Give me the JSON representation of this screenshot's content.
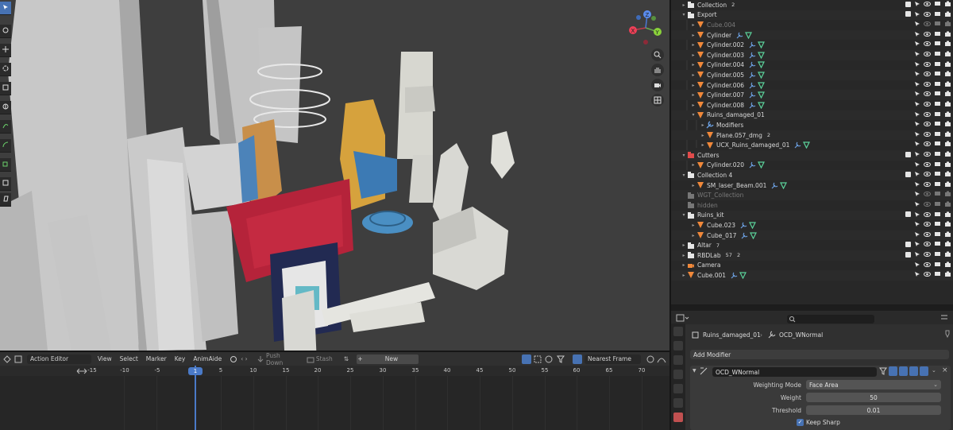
{
  "outliner": {
    "rows": [
      {
        "label": "Collection",
        "dim": false
      },
      {
        "label": "Export",
        "dim": false
      },
      {
        "label": "Cube.004",
        "dim": true
      },
      {
        "label": "Cylinder",
        "dim": false
      },
      {
        "label": "Cylinder.002",
        "dim": false
      },
      {
        "label": "Cylinder.003",
        "dim": false
      },
      {
        "label": "Cylinder.004",
        "dim": false
      },
      {
        "label": "Cylinder.005",
        "dim": false
      },
      {
        "label": "Cylinder.006",
        "dim": false
      },
      {
        "label": "Cylinder.007",
        "dim": false
      },
      {
        "label": "Cylinder.008",
        "dim": false
      },
      {
        "label": "Ruins_damaged_01",
        "dim": false
      },
      {
        "label": "Modifiers",
        "dim": false
      },
      {
        "label": "Plane.057_dmg",
        "dim": false
      },
      {
        "label": "UCX_Ruins_damaged_01",
        "dim": false
      },
      {
        "label": "Cutters",
        "dim": false
      },
      {
        "label": "Cylinder.020",
        "dim": false
      },
      {
        "label": "Collection 4",
        "dim": false
      },
      {
        "label": "SM_laser_Beam.001",
        "dim": false
      },
      {
        "label": "WGT_Collection",
        "dim": true
      },
      {
        "label": "hidden",
        "dim": true
      },
      {
        "label": "Ruins_kit",
        "dim": false
      },
      {
        "label": "Cube.023",
        "dim": false
      },
      {
        "label": "Cube_017",
        "dim": false
      },
      {
        "label": "Altar",
        "dim": false
      },
      {
        "label": "RBDLab",
        "dim": false
      },
      {
        "label": "Camera",
        "dim": false
      },
      {
        "label": "Cube.001",
        "dim": false
      }
    ],
    "counts": {
      "collection": "2",
      "altar": "7",
      "rbdlab_a": "57",
      "rbdlab_b": "2",
      "plane_dmg": "2"
    }
  },
  "properties": {
    "breadcrumb_object": "Ruins_damaged_01",
    "breadcrumb_modifier": "OCD_WNormal",
    "add_modifier": "Add Modifier",
    "modifier_name": "OCD_WNormal",
    "weighting_mode_label": "Weighting Mode",
    "weighting_mode_value": "Face Area",
    "weight_label": "Weight",
    "weight_value": "50",
    "threshold_label": "Threshold",
    "threshold_value": "0.01",
    "keep_sharp_label": "Keep Sharp"
  },
  "timeline": {
    "editor_type": "Action Editor",
    "menus": [
      "View",
      "Select",
      "Marker",
      "Key",
      "AnimAide"
    ],
    "push_down": "Push Down",
    "stash": "Stash",
    "new": "New",
    "snap": "Nearest Frame",
    "current_frame": "1",
    "ticks": [
      "-15",
      "-10",
      "-5",
      "1",
      "5",
      "10",
      "15",
      "20",
      "25",
      "30",
      "35",
      "40",
      "45",
      "50",
      "55",
      "60",
      "65",
      "70"
    ]
  },
  "viewport": {
    "gizmo": {
      "x": "X",
      "y": "Y",
      "z": "Z"
    }
  },
  "colors": {
    "accent": "#4772b3",
    "mesh_icon": "#f0883a",
    "collection_check": "#e6e6e6"
  }
}
